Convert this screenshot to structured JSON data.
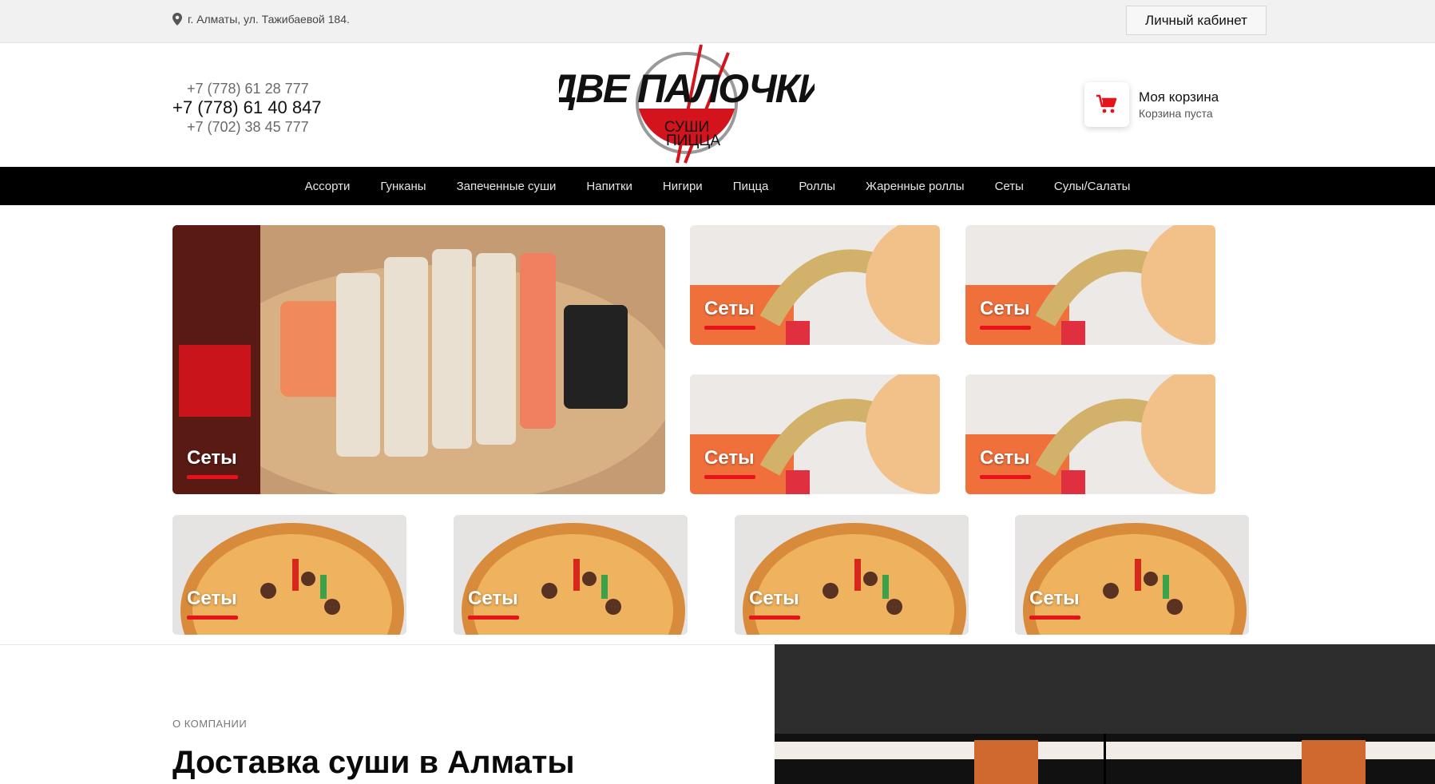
{
  "topbar": {
    "address": "г. Алматы, ул. Тажибаевой 184.",
    "cabinet_label": "Личный кабинет"
  },
  "header": {
    "phones": [
      "+7 (778) 61 28 777",
      "+7 (778) 61 40 847",
      "+7 (702) 38 45 777"
    ],
    "logo": {
      "main_text": "ДВЕ ПАЛОЧКИ",
      "sub_line1": "СУШИ",
      "sub_line2": "ПИЦЦА"
    },
    "cart": {
      "title": "Моя корзина",
      "status": "Корзина пуста"
    }
  },
  "nav": {
    "items": [
      "Ассорти",
      "Гунканы",
      "Запеченные суши",
      "Напитки",
      "Нигири",
      "Пицца",
      "Роллы",
      "Жаренные роллы",
      "Сеты",
      "Сулы/Салаты"
    ]
  },
  "tiles": {
    "big": "Сеты",
    "small": [
      "Сеты",
      "Сеты",
      "Сеты",
      "Сеты"
    ],
    "pizza": [
      "Сеты",
      "Сеты",
      "Сеты",
      "Сеты"
    ]
  },
  "about": {
    "eyebrow": "О КОМПАНИИ",
    "title": "Доставка суши в Алматы"
  },
  "colors": {
    "accent": "#e8131a",
    "nav_bg": "#000000",
    "topbar_bg": "#f1f1f1"
  }
}
